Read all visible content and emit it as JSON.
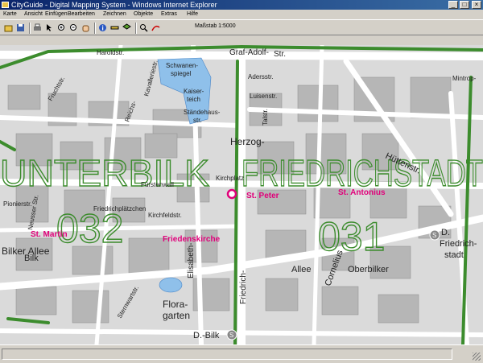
{
  "window": {
    "title": "CityGuide - Digital Mapping System - Windows Internet Explorer",
    "controls": {
      "minimize": "_",
      "maximize": "□",
      "close": "×"
    }
  },
  "menu": [
    "Karte",
    "Ansicht",
    "Einfügen",
    "Bearbeiten",
    "Zeichnen",
    "Objekte",
    "Extras",
    "Hilfe"
  ],
  "toolbar": {
    "icons": [
      "open-icon",
      "save-icon",
      "print-icon",
      "select-arrow-icon",
      "zoom-in-icon",
      "zoom-out-icon",
      "pan-hand-icon",
      "info-icon",
      "measure-icon",
      "layers-icon",
      "search-icon",
      "route-icon"
    ],
    "zoom_label": "Maßstab 1:5000"
  },
  "map": {
    "colors": {
      "background": "#dadada",
      "buildings": "#b6b6b6",
      "roads": "#ffffff",
      "district_boundary": "#3c8c2d",
      "poi": "#e0007a",
      "water": "#8fc0ea"
    },
    "districts": [
      {
        "name": "UNTERBILK",
        "number": "032"
      },
      {
        "name": "FRIEDRICHSTADT",
        "number": "031"
      }
    ],
    "pois": [
      "St. Peter",
      "St. Antonius",
      "St. Martin",
      "Friedenskirche"
    ],
    "streets": [
      "Haroldstr.",
      "Graf-Adolf-",
      "Str.",
      "Herzog-",
      "Fürstenwall",
      "Kirchplatz",
      "Elisabeth-",
      "Friedrich-",
      "Allee",
      "Cornelius",
      "Oberbilker",
      "Hüttenstr.",
      "Adersstr.",
      "Luisenstr.",
      "Talstr.",
      "Mintrop-",
      "Kavalleriestr.",
      "Bilker Allee",
      "Flora-",
      "garten",
      "Sternwartstr.",
      "Neusser Str.",
      "Kirchfeldstr.",
      "Pionierstr.",
      "Schwanen-",
      "spiegel",
      "Kaiser-",
      "teich",
      "Ständehaus-",
      "str.",
      "Friedrichplätzchen",
      "Bilk",
      "D.-Bilk",
      "D.",
      "Friedrich-",
      "stadt",
      "Reichs-",
      "Fruchtstr."
    ]
  },
  "status": {
    "text": ""
  }
}
